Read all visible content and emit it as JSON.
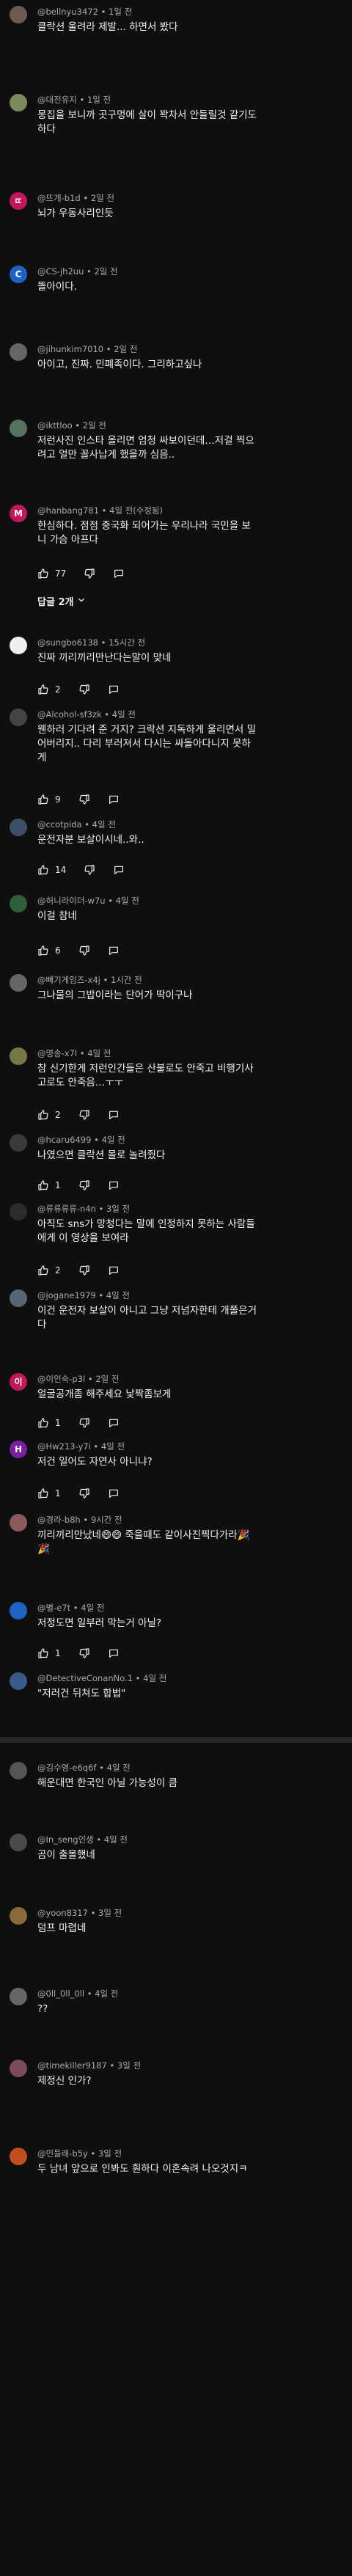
{
  "comments": [
    {
      "author": "@bellnyu3472",
      "time": "1일 전",
      "text": "클락션 울려라 제발... 하면서 봤다",
      "likes": "",
      "avatar_letter": "",
      "avatar_color": "#6d5a53"
    },
    {
      "author": "@대전유지",
      "time": "1일 전",
      "text": "몽집을 보니까 곳구멍에 살이 꽉차서 안들릴것 같기도 하다",
      "likes": "",
      "avatar_letter": "",
      "avatar_color": "#7a8a5a"
    },
    {
      "author": "@뜨개-b1d",
      "time": "2일 전",
      "text": "뇌가 우동사리인듯",
      "likes": "",
      "avatar_letter": "ㄸ",
      "avatar_color": "#c2185b"
    },
    {
      "author": "@CS-jh2uu",
      "time": "2일 전",
      "text": "똘아이다.",
      "likes": "",
      "avatar_letter": "C",
      "avatar_color": "#1e63c4"
    },
    {
      "author": "@jihunkim7010",
      "time": "2일 전",
      "text": "아이고, 진짜. 민폐족이다. 그리하고싶나",
      "likes": "",
      "avatar_letter": "",
      "avatar_color": "#666666"
    },
    {
      "author": "@ikttloo",
      "time": "2일 전",
      "text": "저런사진 인스타 올리면 엄청 싸보이던데…저걸 찍으려고 얼만 꼴사납게 했을까 심음..",
      "likes": "",
      "avatar_letter": "",
      "avatar_color": "#55735c"
    },
    {
      "author": "@hanbang781",
      "time": "4일 전(수정됨)",
      "text": "한심하다. 점점 중국화 되어가는 우리나라 국민을 보니 가슴 아프다",
      "likes": "77",
      "avatar_letter": "M",
      "avatar_color": "#c2185b"
    },
    {
      "author": "@sungbo6138",
      "time": "15시간 전",
      "text": "진짜 끼리끼리만난다는말이 맞네",
      "likes": "2",
      "avatar_letter": "",
      "avatar_color": "#eeeeee"
    },
    {
      "author": "@Alcohol-sf3zk",
      "time": "4일 전",
      "text": "웬하러 기다려 준 거지? 크락션 지독하게 울리면서 밀어버리지.. 다리 부러져서 다시는 싸돌아다니지 못하게",
      "likes": "9",
      "avatar_letter": "",
      "avatar_color": "#444444"
    },
    {
      "author": "@ccotpida",
      "time": "4일 전",
      "text": "운전자분 보살이시네..와..",
      "likes": "14",
      "avatar_letter": "",
      "avatar_color": "#3d4f66"
    },
    {
      "author": "@허니라이더-w7u",
      "time": "4일 전",
      "text": "이걸 참네",
      "likes": "6",
      "avatar_letter": "",
      "avatar_color": "#2e5e3a"
    },
    {
      "author": "@빼기게임즈-x4j",
      "time": "1시간 전",
      "text": "그나물의 그밥이라는 단어가 딱이구나",
      "likes": "",
      "avatar_letter": "",
      "avatar_color": "#666666"
    },
    {
      "author": "@명송-x7l",
      "time": "4일 전",
      "text": "참 신기한게 저런인간들은 산불로도 안죽고 비행기사고로도 안죽음…ㅜㅜ",
      "likes": "2",
      "avatar_letter": "",
      "avatar_color": "#777744"
    },
    {
      "author": "@hcaru6499",
      "time": "4일 전",
      "text": "나였으면 클락션 몰로 놀려줬다",
      "likes": "1",
      "avatar_letter": "",
      "avatar_color": "#3a3a3a"
    },
    {
      "author": "@류류류류-n4n",
      "time": "3일 전",
      "text": "아직도 sns가 망청다는 말에 인정하지 못하는 사람들에게 이 영상을 보여라",
      "likes": "2",
      "avatar_letter": "",
      "avatar_color": "#2b2b2b"
    },
    {
      "author": "@jogane1979",
      "time": "4일 전",
      "text": "이건 운전자 보살이 아니고 그냥 저넘자한테 개쫄은거다",
      "likes": "",
      "avatar_letter": "",
      "avatar_color": "#556677"
    },
    {
      "author": "@이인숙-p3l",
      "time": "2일 전",
      "text": "얼굴공개좀 해주세요 낯짝좀보게",
      "likes": "1",
      "avatar_letter": "이",
      "avatar_color": "#c2185b"
    },
    {
      "author": "@Hw213-y7i",
      "time": "4일 전",
      "text": "저건 일어도 자연사 아니냐?",
      "likes": "1",
      "avatar_letter": "H",
      "avatar_color": "#7b1fa2"
    },
    {
      "author": "@경라-b8h",
      "time": "9시간 전",
      "text": "끼리끼리만났네😄😄 죽을때도 같이사진찍다가라🎉🎉",
      "likes": "",
      "avatar_letter": "",
      "avatar_color": "#8b5a5a"
    },
    {
      "author": "@별-e7t",
      "time": "4일 전",
      "text": "저정도면 일부러 막는거 아닐?",
      "likes": "1",
      "avatar_letter": "",
      "avatar_color": "#1e63c4"
    },
    {
      "author": "@DetectiveConanNo.1",
      "time": "4일 전",
      "text": "\"저러건 뒤쳐도 합법\"",
      "likes": "",
      "avatar_letter": "",
      "avatar_color": "#3a5a8a"
    },
    {
      "author": "@김수영-e6q6f",
      "time": "4일 전",
      "text": "해운대면 한국인 아닐 가능성이 큼",
      "likes": "",
      "avatar_letter": "",
      "avatar_color": "#555555"
    },
    {
      "author": "@In_seng인생",
      "time": "4일 전",
      "text": "곰이 출몰했네",
      "likes": "",
      "avatar_letter": "",
      "avatar_color": "#4a4a4a"
    },
    {
      "author": "@yoon8317",
      "time": "3일 전",
      "text": "덤프 마렵네",
      "likes": "",
      "avatar_letter": "",
      "avatar_color": "#8a6a3a"
    },
    {
      "author": "@0ll_0ll_0ll",
      "time": "4일 전",
      "text": "??",
      "likes": "",
      "avatar_letter": "",
      "avatar_color": "#666666"
    },
    {
      "author": "@timekiller9187",
      "time": "3일 전",
      "text": "제정신 인가?",
      "likes": "",
      "avatar_letter": "",
      "avatar_color": "#7a4a5a"
    },
    {
      "author": "@민들래-b5y",
      "time": "3일 전",
      "text": "두 남녀 앞으로 인봐도 훤하다 이혼속려 나오것지ㅋ",
      "likes": "",
      "avatar_letter": "",
      "avatar_color": "#c24e1e"
    }
  ],
  "reply_toggle_label": "답글 2개",
  "icons": {
    "like": "thumb-up-icon",
    "dislike": "thumb-down-icon",
    "reply": "comment-icon",
    "expand": "chevron-down-icon"
  }
}
